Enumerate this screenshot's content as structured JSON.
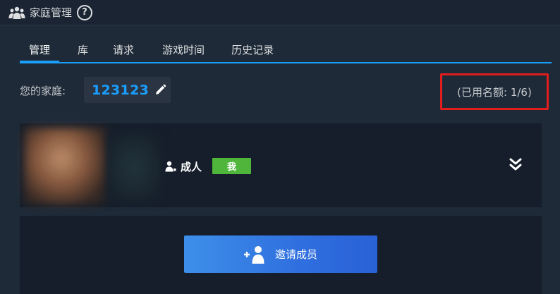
{
  "window": {
    "title": "家庭管理",
    "help_icon": "help-circle-icon",
    "title_icon": "family-icon"
  },
  "tabs": [
    {
      "label": "管理",
      "active": true
    },
    {
      "label": "库",
      "active": false
    },
    {
      "label": "请求",
      "active": false
    },
    {
      "label": "游戏时间",
      "active": false
    },
    {
      "label": "历史记录",
      "active": false
    }
  ],
  "family": {
    "label": "您的家庭:",
    "name": "123123",
    "edit_icon": "pencil-icon",
    "quota_text": "(已用名额: 1/6)"
  },
  "member": {
    "role_label": "成人",
    "role_icon": "person-icon",
    "badge": "我",
    "expand_icon": "double-chevron-down-icon"
  },
  "invite": {
    "button_label": "邀请成员",
    "icon": "add-person-icon"
  },
  "colors": {
    "accent": "#1a9fff",
    "badge_green": "#4fb53b",
    "highlight_red": "#e21d1d",
    "background": "#1e2a38",
    "card": "#151e2a"
  }
}
